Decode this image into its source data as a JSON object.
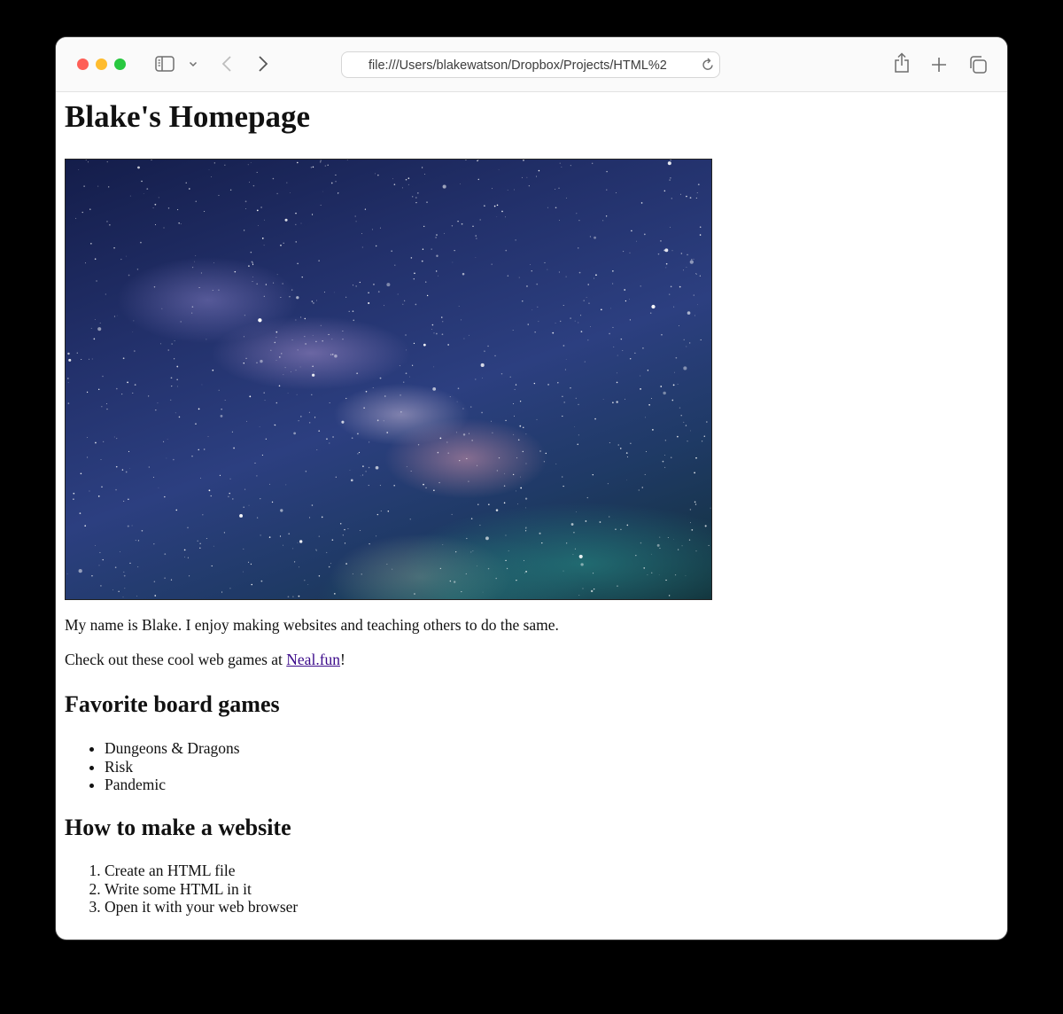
{
  "browser": {
    "address": "file:///Users/blakewatson/Dropbox/Projects/HTML%2",
    "icons": [
      "sidebar-icon",
      "chevron-down-icon",
      "back-icon",
      "forward-icon",
      "reload-icon",
      "share-icon",
      "new-tab-icon",
      "tabs-overview-icon"
    ],
    "traffic_light_colors": {
      "close": "#fe5f57",
      "minimize": "#febc2e",
      "maximize": "#28c840"
    }
  },
  "page": {
    "title": "Blake's Homepage",
    "intro": "My name is Blake. I enjoy making websites and teaching others to do the same.",
    "games_text_before": "Check out these cool web games at ",
    "games_link": "Neal.fun",
    "games_text_after": "!",
    "link_color": "#3b0a8a",
    "board_games_heading": "Favorite board games",
    "board_games": [
      "Dungeons & Dragons",
      "Risk",
      "Pandemic"
    ],
    "howto_heading": "How to make a website",
    "howto_steps": [
      "Create an HTML file",
      "Write some HTML in it",
      "Open it with your web browser"
    ]
  }
}
